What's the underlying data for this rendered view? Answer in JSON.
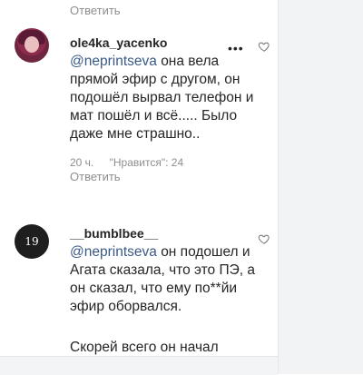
{
  "top": {
    "reply_label": "Ответить"
  },
  "comments": [
    {
      "username": "ole4ka_yacenko",
      "mention": "@neprintseva",
      "text": "она вела прямой эфир с другом, он подошёл вырвал телефон и мат пошёл и всё..... Было даже мне страшно..",
      "time": "20 ч.",
      "likes": "\"Нравится\": 24",
      "reply_label": "Ответить",
      "more_icon": "more-options-icon",
      "like_icon": "heart-icon"
    },
    {
      "username": "__bumblbee__",
      "avatar_text": "19",
      "mention": "@neprintseva",
      "text": "он подошел и Агата сказала, что это ПЭ, а он сказал, что ему по**йи эфир оборвался.",
      "cut_text": "Скорей всего он начал",
      "like_icon": "heart-icon"
    }
  ],
  "colors": {
    "mention": "#3a5a86",
    "meta": "#8e8e8e",
    "text": "#262626",
    "side_panel": "#f2f3f5"
  }
}
